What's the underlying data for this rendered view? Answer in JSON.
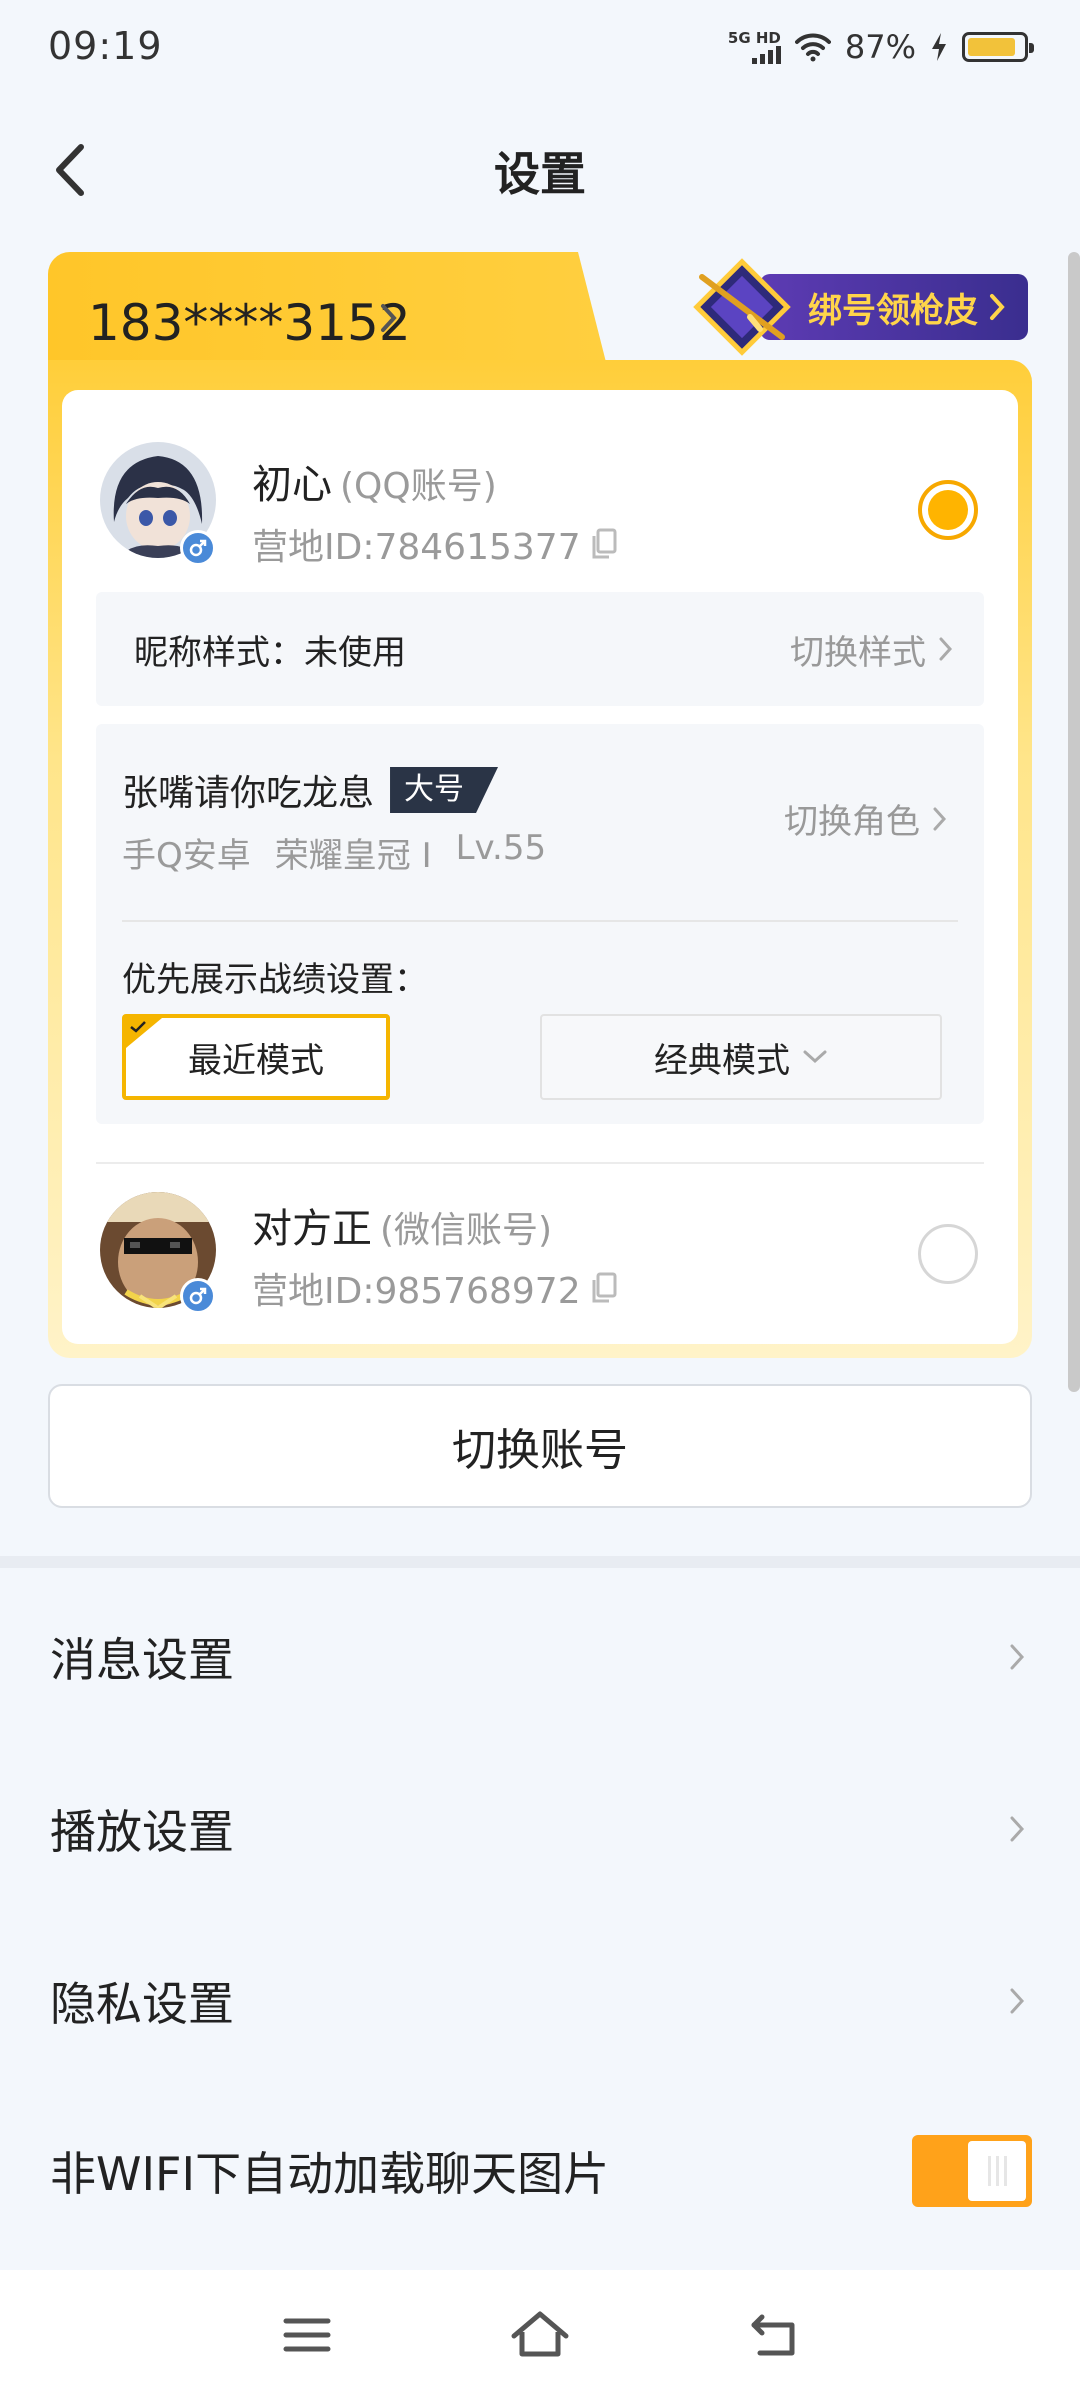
{
  "status_bar": {
    "time": "09:19",
    "network_label": "5G HD",
    "battery_percent": "87%",
    "battery_level": 0.87,
    "icons": [
      "signal-icon",
      "wifi-icon",
      "charging-icon",
      "battery-icon"
    ]
  },
  "header": {
    "title": "设置",
    "back_icon": "back-arrow-icon"
  },
  "account_card": {
    "phone": "183****3152",
    "promo_label": "绑号领枪皮",
    "accounts": [
      {
        "name": "初心",
        "type": "(QQ账号)",
        "camp_id": "营地ID:784615377",
        "selected": true,
        "gender": "male"
      },
      {
        "name": "对方正",
        "type": "(微信账号)",
        "camp_id": "营地ID:985768972",
        "selected": false,
        "gender": "male"
      }
    ],
    "nickname_style": {
      "label": "昵称样式：未使用",
      "action": "切换样式"
    },
    "role": {
      "name": "张嘴请你吃龙息",
      "tag": "大号",
      "platform": "手Q安卓",
      "rank": "荣耀皇冠 I",
      "level": "Lv.55",
      "action": "切换角色"
    },
    "record_pref": {
      "label": "优先展示战绩设置：",
      "modes": [
        "最近模式",
        "经典模式"
      ],
      "selected": "最近模式"
    }
  },
  "switch_account_label": "切换账号",
  "menu": [
    {
      "label": "消息设置"
    },
    {
      "label": "播放设置"
    },
    {
      "label": "隐私设置"
    }
  ],
  "toggle_row": {
    "label": "非WIFI下自动加载聊天图片",
    "enabled": true
  },
  "colors": {
    "accent": "#ffb400",
    "toggle": "#ffa21a",
    "promo_bg": "#4a34a0",
    "promo_text": "#ffd54a"
  }
}
